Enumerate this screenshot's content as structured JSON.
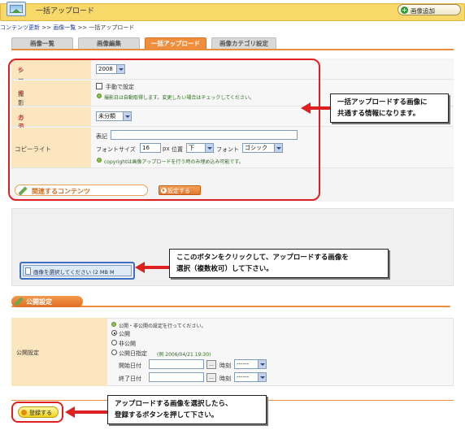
{
  "header": {
    "title": "一括アップロード",
    "add_button": "画像追加"
  },
  "breadcrumb": {
    "items": [
      "コンテンツ更新",
      "画像一覧",
      "一括アップロード"
    ],
    "separator": ">>"
  },
  "tabs": [
    "画像一覧",
    "画像編集",
    "一括アップロード",
    "画像カテゴリ設定"
  ],
  "form": {
    "season": {
      "label": "シーズン",
      "mark": "※",
      "value": "2008"
    },
    "shoot_date": {
      "label": "撮影日",
      "mark": "※",
      "checkbox": "手動で設定",
      "hint": "撮影日は自動取得します。変更したい場合はチェックしてください。"
    },
    "category": {
      "label": "カテゴリ",
      "mark": "必須",
      "value": "未分類"
    },
    "copyright": {
      "label": "コピーライト",
      "notation_label": "表記",
      "notation_value": "",
      "font_size_label": "フォントサイズ",
      "font_size_value": "16",
      "font_size_unit": "px",
      "position_label": "位置",
      "position_value": "下",
      "font_label": "フォント",
      "font_value": "ゴシック",
      "hint": "copyrightは画像アップロードを行う時のみ埋め込み可能です。"
    },
    "related_button": "関連するコンテンツ",
    "set_button": "設定する"
  },
  "callouts": {
    "common": [
      "一括アップロードする画像に",
      "共通する情報になります。"
    ],
    "select": [
      "ここのボタンをクリックして、アップロードする画像を",
      "選択（複数枚可）して下さい。"
    ],
    "register": [
      "アップロードする画像を選択したら、",
      "登録するボタンを押して下さい。"
    ]
  },
  "upload": {
    "button": "画像を選択してください (2 MB M"
  },
  "publish": {
    "heading": "公開設定",
    "label": "公開設定",
    "hint": "公開・非公開の設定を行ってください。",
    "options": [
      "公開",
      "非公開",
      "公開日指定"
    ],
    "example": "(例 2006/04/21 19:30)",
    "start_label": "開始日付",
    "end_label": "終了日付",
    "time_label": "時刻",
    "time_value": "------",
    "dot_button": "..."
  },
  "register_button": "登録する",
  "colors": {
    "accent": "#ef8f3d",
    "header": "#f9d86a",
    "label_bg": "#fbe6c0",
    "highlight": "#e02020",
    "link": "#2242a8"
  }
}
